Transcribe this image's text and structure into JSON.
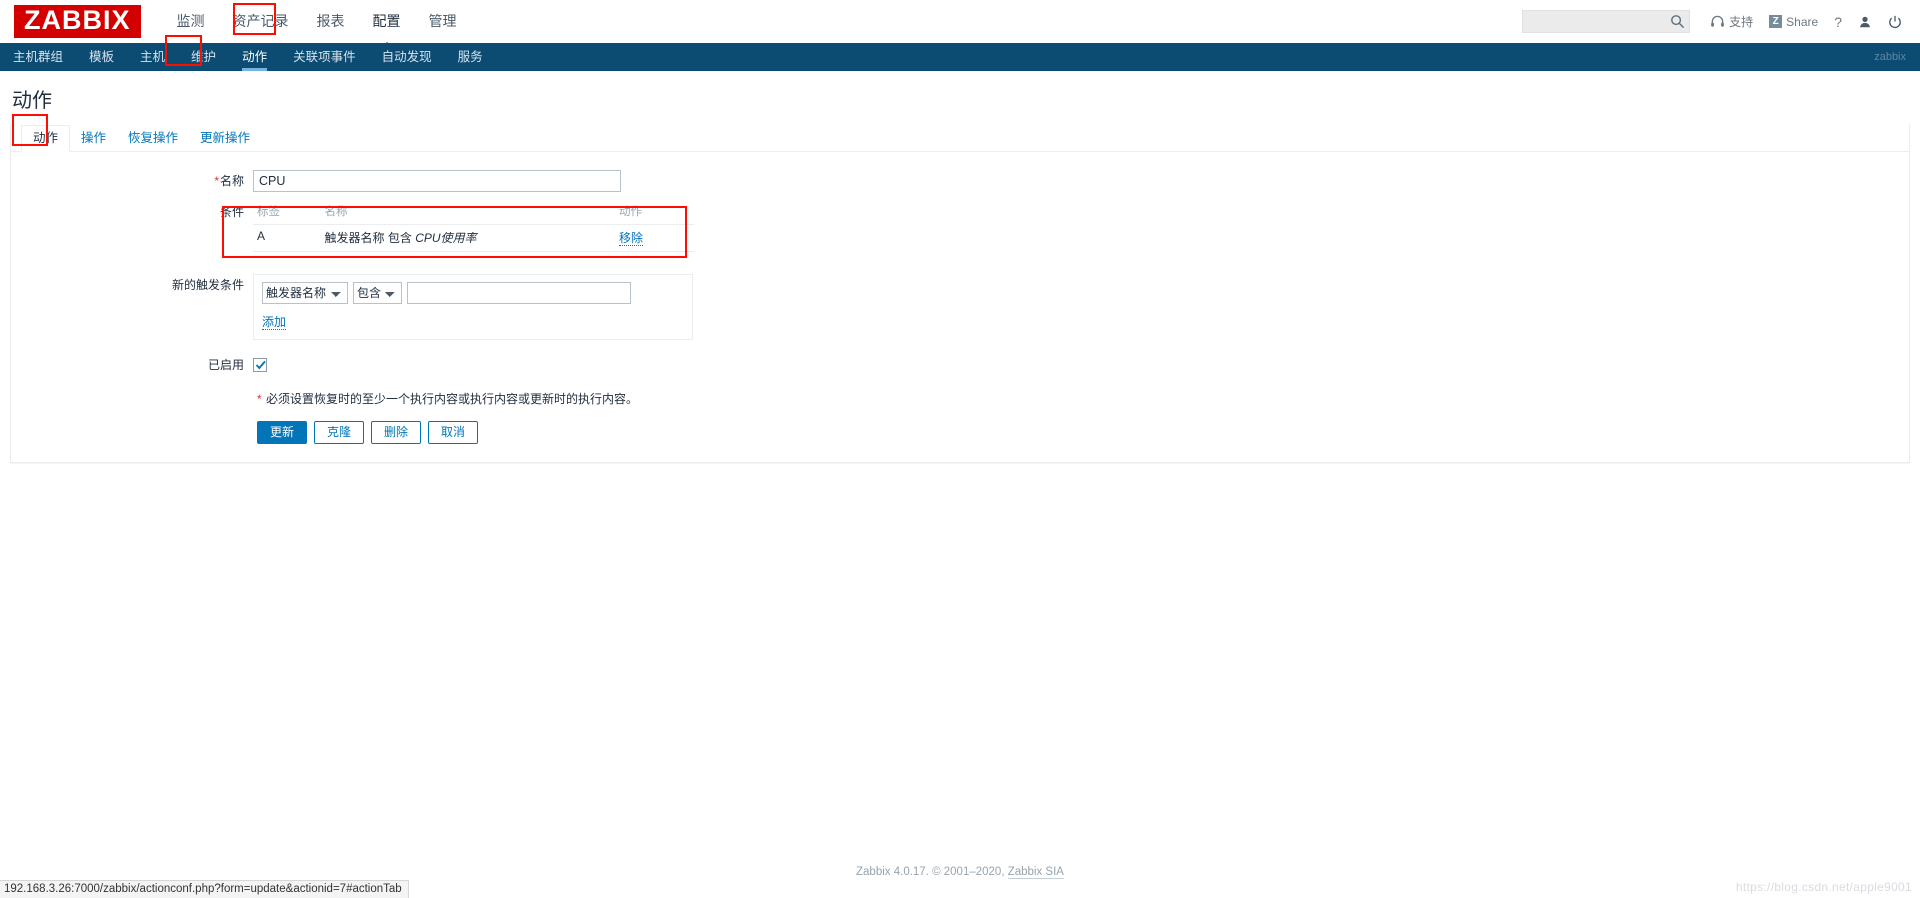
{
  "brand": {
    "logo": "ZABBIX",
    "accent": "#d40000",
    "nav_bg": "#0c4b72",
    "link": "#0275b8"
  },
  "header": {
    "menu": [
      {
        "label": "监测",
        "selected": false
      },
      {
        "label": "资产记录",
        "selected": false
      },
      {
        "label": "报表",
        "selected": false
      },
      {
        "label": "配置",
        "selected": true
      },
      {
        "label": "管理",
        "selected": false
      }
    ],
    "search_placeholder": "",
    "search_value": "",
    "support_label": "支持",
    "share_label": "Share",
    "share_mark": "Z",
    "help_label": "?"
  },
  "subnav": {
    "items": [
      {
        "label": "主机群组",
        "selected": false
      },
      {
        "label": "模板",
        "selected": false
      },
      {
        "label": "主机",
        "selected": false
      },
      {
        "label": "维护",
        "selected": false
      },
      {
        "label": "动作",
        "selected": true
      },
      {
        "label": "关联项事件",
        "selected": false
      },
      {
        "label": "自动发现",
        "selected": false
      },
      {
        "label": "服务",
        "selected": false
      }
    ],
    "user": "zabbix"
  },
  "page": {
    "title": "动作",
    "tabs": [
      {
        "label": "动作",
        "active": true
      },
      {
        "label": "操作",
        "active": false
      },
      {
        "label": "恢复操作",
        "active": false
      },
      {
        "label": "更新操作",
        "active": false
      }
    ]
  },
  "form": {
    "name_label": "名称",
    "name_value": "CPU",
    "conditions_label": "条件",
    "conditions_headers": {
      "label": "标签",
      "name": "名称",
      "action": "动作"
    },
    "conditions": [
      {
        "label": "A",
        "name_prefix": "触发器名称 包含 ",
        "name_value": "CPU使用率",
        "action": "移除"
      }
    ],
    "new_condition_label": "新的触发条件",
    "new_condition": {
      "type_selected": "触发器名称",
      "type_options": [
        "触发器名称"
      ],
      "operator_selected": "包含",
      "operator_options": [
        "包含"
      ],
      "value": "",
      "value_placeholder": "",
      "add_label": "添加"
    },
    "enabled_label": "已启用",
    "enabled_checked": true,
    "footnote_mark": "*",
    "footnote": "必须设置恢复时的至少一个执行内容或执行内容或更新时的执行内容。",
    "buttons": [
      {
        "label": "更新",
        "primary": true
      },
      {
        "label": "克隆",
        "primary": false
      },
      {
        "label": "删除",
        "primary": false
      },
      {
        "label": "取消",
        "primary": false
      }
    ]
  },
  "footer": {
    "copyright": "Zabbix 4.0.17. © 2001–2020, ",
    "link": "Zabbix SIA",
    "status_url": "192.168.3.26:7000/zabbix/actionconf.php?form=update&actionid=7#actionTab",
    "watermark": "https://blog.csdn.net/apple9001"
  }
}
